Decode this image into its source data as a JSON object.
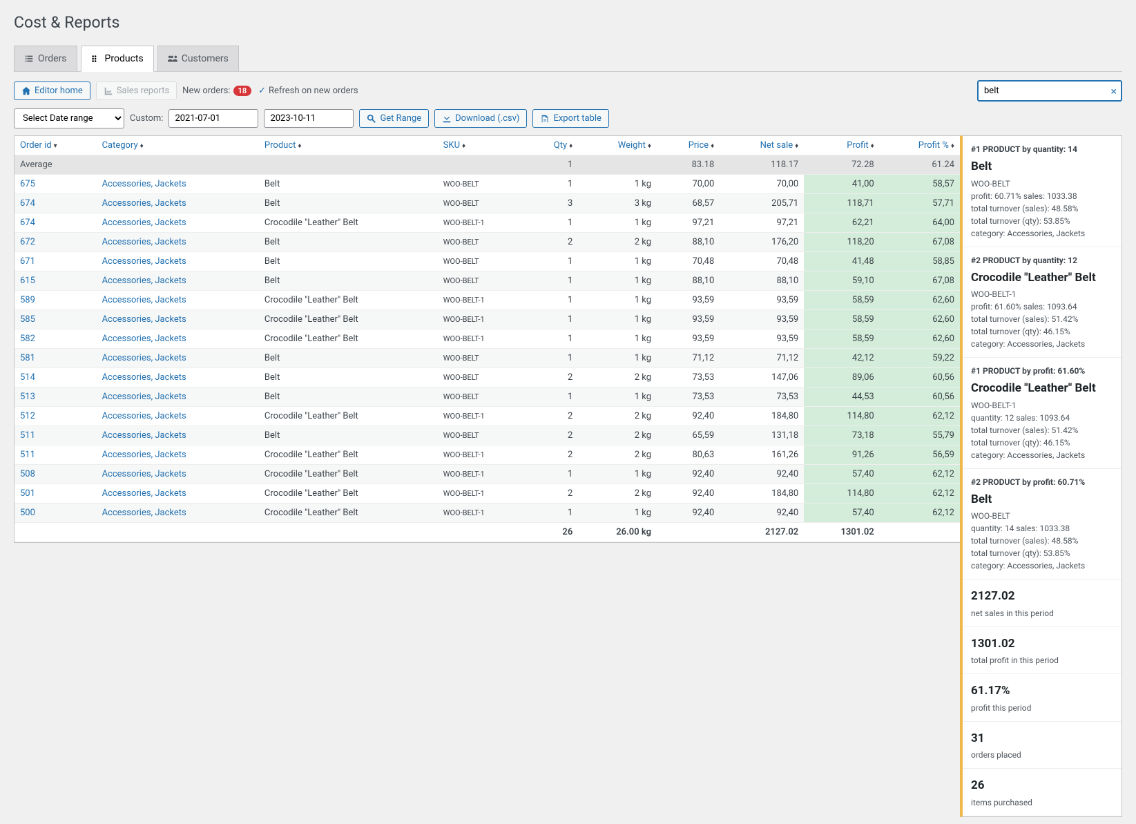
{
  "page_title": "Cost & Reports",
  "tabs": [
    {
      "icon": "list",
      "label": "Orders"
    },
    {
      "icon": "dots",
      "label": "Products"
    },
    {
      "icon": "users",
      "label": "Customers"
    }
  ],
  "toolbar": {
    "editor_home": "Editor home",
    "sales_reports": "Sales reports",
    "new_orders_label": "New orders:",
    "new_orders_count": "18",
    "refresh_label": "Refresh on new orders"
  },
  "search": {
    "value": "belt"
  },
  "controls": {
    "date_range_select": "Select Date range",
    "custom_label": "Custom:",
    "date_from": "2021-07-01",
    "date_to": "2023-10-11",
    "get_range": "Get Range",
    "download": "Download (.csv)",
    "export": "Export table"
  },
  "table": {
    "avg_label": "Average",
    "headers": {
      "order_id": "Order id",
      "category": "Category",
      "product": "Product",
      "sku": "SKU",
      "qty": "Qty",
      "weight": "Weight",
      "price": "Price",
      "net": "Net sale",
      "profit": "Profit",
      "profit_pct": "Profit %"
    },
    "avg": {
      "qty": "1",
      "weight": "",
      "price": "83.18",
      "net": "118.17",
      "profit": "72.28",
      "profit_pct": "61.24"
    },
    "rows": [
      {
        "id": "675",
        "cat": "Accessories, Jackets",
        "prod": "Belt",
        "sku": "WOO-BELT",
        "qty": "1",
        "wt": "1 kg",
        "price": "70,00",
        "net": "70,00",
        "profit": "41,00",
        "pct": "58,57"
      },
      {
        "id": "674",
        "cat": "Accessories, Jackets",
        "prod": "Belt",
        "sku": "WOO-BELT",
        "qty": "3",
        "wt": "3 kg",
        "price": "68,57",
        "net": "205,71",
        "profit": "118,71",
        "pct": "57,71"
      },
      {
        "id": "674",
        "cat": "Accessories, Jackets",
        "prod": "Crocodile \"Leather\" Belt",
        "sku": "WOO-BELT-1",
        "qty": "1",
        "wt": "1 kg",
        "price": "97,21",
        "net": "97,21",
        "profit": "62,21",
        "pct": "64,00"
      },
      {
        "id": "672",
        "cat": "Accessories, Jackets",
        "prod": "Belt",
        "sku": "WOO-BELT",
        "qty": "2",
        "wt": "2 kg",
        "price": "88,10",
        "net": "176,20",
        "profit": "118,20",
        "pct": "67,08"
      },
      {
        "id": "671",
        "cat": "Accessories, Jackets",
        "prod": "Belt",
        "sku": "WOO-BELT",
        "qty": "1",
        "wt": "1 kg",
        "price": "70,48",
        "net": "70,48",
        "profit": "41,48",
        "pct": "58,85"
      },
      {
        "id": "615",
        "cat": "Accessories, Jackets",
        "prod": "Belt",
        "sku": "WOO-BELT",
        "qty": "1",
        "wt": "1 kg",
        "price": "88,10",
        "net": "88,10",
        "profit": "59,10",
        "pct": "67,08"
      },
      {
        "id": "589",
        "cat": "Accessories, Jackets",
        "prod": "Crocodile \"Leather\" Belt",
        "sku": "WOO-BELT-1",
        "qty": "1",
        "wt": "1 kg",
        "price": "93,59",
        "net": "93,59",
        "profit": "58,59",
        "pct": "62,60"
      },
      {
        "id": "585",
        "cat": "Accessories, Jackets",
        "prod": "Crocodile \"Leather\" Belt",
        "sku": "WOO-BELT-1",
        "qty": "1",
        "wt": "1 kg",
        "price": "93,59",
        "net": "93,59",
        "profit": "58,59",
        "pct": "62,60"
      },
      {
        "id": "582",
        "cat": "Accessories, Jackets",
        "prod": "Crocodile \"Leather\" Belt",
        "sku": "WOO-BELT-1",
        "qty": "1",
        "wt": "1 kg",
        "price": "93,59",
        "net": "93,59",
        "profit": "58,59",
        "pct": "62,60"
      },
      {
        "id": "581",
        "cat": "Accessories, Jackets",
        "prod": "Belt",
        "sku": "WOO-BELT",
        "qty": "1",
        "wt": "1 kg",
        "price": "71,12",
        "net": "71,12",
        "profit": "42,12",
        "pct": "59,22"
      },
      {
        "id": "514",
        "cat": "Accessories, Jackets",
        "prod": "Belt",
        "sku": "WOO-BELT",
        "qty": "2",
        "wt": "2 kg",
        "price": "73,53",
        "net": "147,06",
        "profit": "89,06",
        "pct": "60,56"
      },
      {
        "id": "513",
        "cat": "Accessories, Jackets",
        "prod": "Belt",
        "sku": "WOO-BELT",
        "qty": "1",
        "wt": "1 kg",
        "price": "73,53",
        "net": "73,53",
        "profit": "44,53",
        "pct": "60,56"
      },
      {
        "id": "512",
        "cat": "Accessories, Jackets",
        "prod": "Crocodile \"Leather\" Belt",
        "sku": "WOO-BELT-1",
        "qty": "2",
        "wt": "2 kg",
        "price": "92,40",
        "net": "184,80",
        "profit": "114,80",
        "pct": "62,12"
      },
      {
        "id": "511",
        "cat": "Accessories, Jackets",
        "prod": "Belt",
        "sku": "WOO-BELT",
        "qty": "2",
        "wt": "2 kg",
        "price": "65,59",
        "net": "131,18",
        "profit": "73,18",
        "pct": "55,79"
      },
      {
        "id": "511",
        "cat": "Accessories, Jackets",
        "prod": "Crocodile \"Leather\" Belt",
        "sku": "WOO-BELT-1",
        "qty": "2",
        "wt": "2 kg",
        "price": "80,63",
        "net": "161,26",
        "profit": "91,26",
        "pct": "56,59"
      },
      {
        "id": "508",
        "cat": "Accessories, Jackets",
        "prod": "Crocodile \"Leather\" Belt",
        "sku": "WOO-BELT-1",
        "qty": "1",
        "wt": "1 kg",
        "price": "92,40",
        "net": "92,40",
        "profit": "57,40",
        "pct": "62,12"
      },
      {
        "id": "501",
        "cat": "Accessories, Jackets",
        "prod": "Crocodile \"Leather\" Belt",
        "sku": "WOO-BELT-1",
        "qty": "2",
        "wt": "2 kg",
        "price": "92,40",
        "net": "184,80",
        "profit": "114,80",
        "pct": "62,12"
      },
      {
        "id": "500",
        "cat": "Accessories, Jackets",
        "prod": "Crocodile \"Leather\" Belt",
        "sku": "WOO-BELT-1",
        "qty": "1",
        "wt": "1 kg",
        "price": "92,40",
        "net": "92,40",
        "profit": "57,40",
        "pct": "62,12"
      }
    ],
    "totals": {
      "qty": "26",
      "wt": "26.00 kg",
      "net": "2127.02",
      "profit": "1301.02"
    }
  },
  "summary": {
    "p1q": {
      "title": "#1 PRODUCT by quantity: 14",
      "name": "Belt",
      "sku": "WOO-BELT",
      "l1": "profit: 60.71% sales: 1033.38",
      "l2": "total turnover (sales): 48.58%",
      "l3": "total turnover (qty): 53.85%",
      "l4": "category: Accessories, Jackets"
    },
    "p2q": {
      "title": "#2 PRODUCT by quantity: 12",
      "name": "Crocodile \"Leather\" Belt",
      "sku": "WOO-BELT-1",
      "l1": "profit: 61.60% sales: 1093.64",
      "l2": "total turnover (sales): 51.42%",
      "l3": "total turnover (qty): 46.15%",
      "l4": "category: Accessories, Jackets"
    },
    "p1p": {
      "title": "#1 PRODUCT by profit: 61.60%",
      "name": "Crocodile \"Leather\" Belt",
      "sku": "WOO-BELT-1",
      "l1": "quantity: 12 sales: 1093.64",
      "l2": "total turnover (sales): 51.42%",
      "l3": "total turnover (qty): 46.15%",
      "l4": "category: Accessories, Jackets"
    },
    "p2p": {
      "title": "#2 PRODUCT by profit: 60.71%",
      "name": "Belt",
      "sku": "WOO-BELT",
      "l1": "quantity: 14 sales: 1033.38",
      "l2": "total turnover (sales): 48.58%",
      "l3": "total turnover (qty): 53.85%",
      "l4": "category: Accessories, Jackets"
    },
    "net": {
      "val": "2127.02",
      "label": "net sales in this period"
    },
    "profit": {
      "val": "1301.02",
      "label": "total profit in this period"
    },
    "pct": {
      "val": "61.17%",
      "label": "profit this period"
    },
    "orders": {
      "val": "31",
      "label": "orders placed"
    },
    "items": {
      "val": "26",
      "label": "items purchased"
    }
  }
}
